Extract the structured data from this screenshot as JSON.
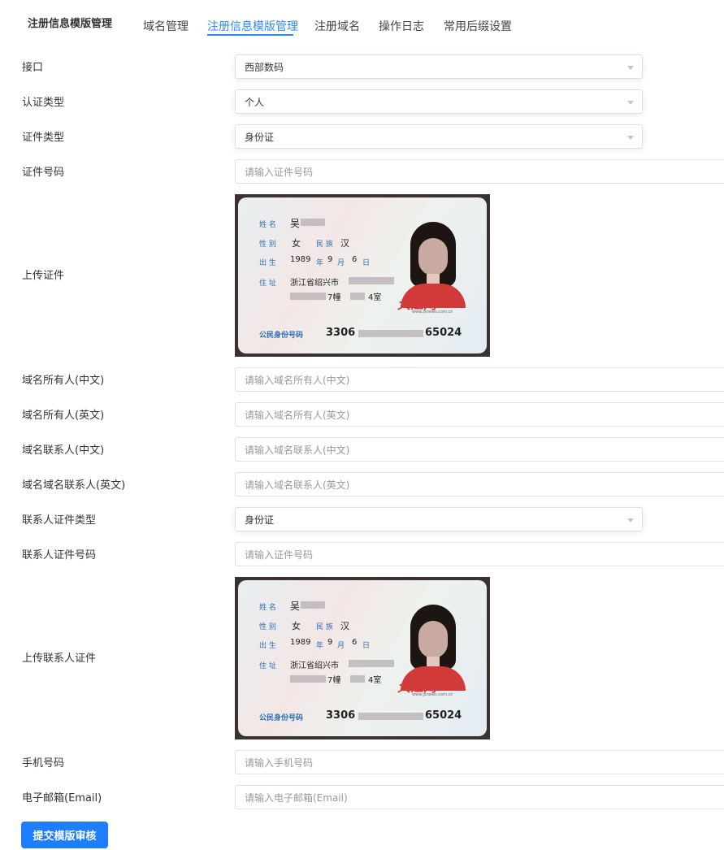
{
  "header": {
    "title": "注册信息模版管理",
    "tabs": [
      {
        "label": "域名管理"
      },
      {
        "label": "注册信息模版管理"
      },
      {
        "label": "注册域名"
      },
      {
        "label": "操作日志"
      },
      {
        "label": "常用后缀设置"
      }
    ],
    "active_tab": "注册信息模版管理",
    "accent_color": "#2d8cf0"
  },
  "form": {
    "interface": {
      "label": "接口",
      "value": "西部数码"
    },
    "cert_kind": {
      "label": "认证类型",
      "value": "个人"
    },
    "id_type": {
      "label": "证件类型",
      "value": "身份证"
    },
    "id_number": {
      "label": "证件号码",
      "placeholder": "请输入证件号码"
    },
    "upload_id": {
      "label": "上传证件"
    },
    "owner_cn": {
      "label": "域名所有人(中文)",
      "placeholder": "请输入域名所有人(中文)"
    },
    "owner_en": {
      "label": "域名所有人(英文)",
      "placeholder": "请输入域名所有人(英文)"
    },
    "contact_cn": {
      "label": "域名联系人(中文)",
      "placeholder": "请输入域名联系人(中文)"
    },
    "contact_en": {
      "label": "域名域名联系人(英文)",
      "placeholder": "请输入域名联系人(英文)"
    },
    "contact_id_type": {
      "label": "联系人证件类型",
      "value": "身份证"
    },
    "contact_id_number": {
      "label": "联系人证件号码",
      "placeholder": "请输入证件号码"
    },
    "upload_contact_id": {
      "label": "上传联系人证件"
    },
    "phone": {
      "label": "手机号码",
      "placeholder": "请输入手机号码"
    },
    "email": {
      "label": "电子邮箱(Email)",
      "placeholder": "请输入电子邮箱(Email)"
    }
  },
  "id_card": {
    "name_label": "姓 名",
    "name_value": "吴",
    "sex_label": "性 别",
    "sex_value": "女",
    "ethnic_label": "民 族",
    "ethnic_value": "汉",
    "birth_label": "出 生",
    "birth_year": "1989",
    "year_unit": "年",
    "birth_month": "9",
    "month_unit": "月",
    "birth_day": "6",
    "day_unit": "日",
    "addr_label": "住 址",
    "addr_line1": "浙江省绍兴市",
    "addr_line2_a": "7幢",
    "addr_line2_b": "4室",
    "id_label": "公民身份号码",
    "id_prefix": "3306",
    "id_suffix": "65024",
    "watermark": "大江网",
    "watermark_url": "www.jxnews.com.cn"
  },
  "submit": {
    "label": "提交模版审核",
    "color": "#1e7eff"
  }
}
